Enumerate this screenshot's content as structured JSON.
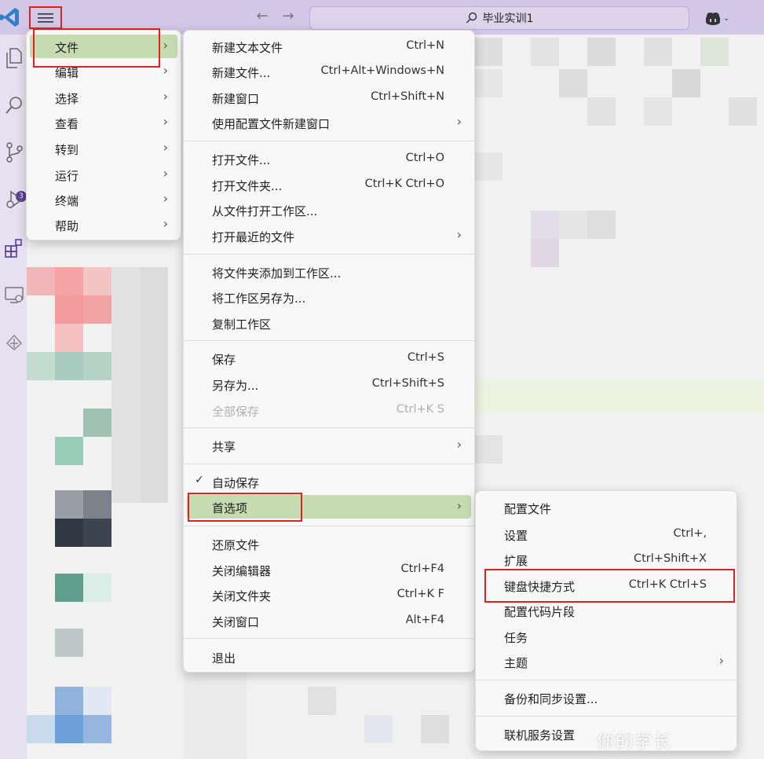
{
  "titlebar": {
    "search_text": "毕业实训1",
    "copilot_icon": "copilot-icon",
    "back_icon": "arrow-left-icon",
    "forward_icon": "arrow-right-icon"
  },
  "activitybar": {
    "icons": [
      "explorer-icon",
      "search-icon",
      "source-control-icon",
      "run-debug-icon",
      "extensions-icon",
      "remote-explorer-icon",
      "other-icon"
    ],
    "source_control_badge": "3"
  },
  "main_menu": {
    "items": [
      {
        "label": "文件",
        "submenu": true
      },
      {
        "label": "编辑",
        "submenu": true
      },
      {
        "label": "选择",
        "submenu": true
      },
      {
        "label": "查看",
        "submenu": true
      },
      {
        "label": "转到",
        "submenu": true
      },
      {
        "label": "运行",
        "submenu": true
      },
      {
        "label": "终端",
        "submenu": true
      },
      {
        "label": "帮助",
        "submenu": true
      }
    ]
  },
  "file_menu": {
    "groups": [
      [
        {
          "label": "新建文本文件",
          "shortcut": "Ctrl+N"
        },
        {
          "label": "新建文件...",
          "shortcut": "Ctrl+Alt+Windows+N"
        },
        {
          "label": "新建窗口",
          "shortcut": "Ctrl+Shift+N"
        },
        {
          "label": "使用配置文件新建窗口",
          "shortcut": "",
          "submenu": true
        }
      ],
      [
        {
          "label": "打开文件...",
          "shortcut": "Ctrl+O"
        },
        {
          "label": "打开文件夹...",
          "shortcut": "Ctrl+K Ctrl+O"
        },
        {
          "label": "从文件打开工作区...",
          "shortcut": ""
        },
        {
          "label": "打开最近的文件",
          "shortcut": "",
          "submenu": true
        }
      ],
      [
        {
          "label": "将文件夹添加到工作区...",
          "shortcut": ""
        },
        {
          "label": "将工作区另存为...",
          "shortcut": ""
        },
        {
          "label": "复制工作区",
          "shortcut": ""
        }
      ],
      [
        {
          "label": "保存",
          "shortcut": "Ctrl+S"
        },
        {
          "label": "另存为...",
          "shortcut": "Ctrl+Shift+S"
        },
        {
          "label": "全部保存",
          "shortcut": "Ctrl+K S",
          "disabled": true
        }
      ],
      [
        {
          "label": "共享",
          "shortcut": "",
          "submenu": true
        }
      ],
      [
        {
          "label": "自动保存",
          "shortcut": "",
          "checked": true
        },
        {
          "label": "首选项",
          "shortcut": "",
          "submenu": true,
          "highlighted": true
        }
      ],
      [
        {
          "label": "还原文件",
          "shortcut": ""
        },
        {
          "label": "关闭编辑器",
          "shortcut": "Ctrl+F4"
        },
        {
          "label": "关闭文件夹",
          "shortcut": "Ctrl+K F"
        },
        {
          "label": "关闭窗口",
          "shortcut": "Alt+F4"
        }
      ],
      [
        {
          "label": "退出",
          "shortcut": ""
        }
      ]
    ]
  },
  "preferences_menu": {
    "groups": [
      [
        {
          "label": "配置文件",
          "shortcut": ""
        },
        {
          "label": "设置",
          "shortcut": "Ctrl+,"
        },
        {
          "label": "扩展",
          "shortcut": "Ctrl+Shift+X"
        },
        {
          "label": "键盘快捷方式",
          "shortcut": "Ctrl+K Ctrl+S"
        },
        {
          "label": "配置代码片段",
          "shortcut": ""
        },
        {
          "label": "任务",
          "shortcut": ""
        },
        {
          "label": "主题",
          "shortcut": "",
          "submenu": true
        }
      ],
      [
        {
          "label": "备份和同步设置...",
          "shortcut": ""
        }
      ],
      [
        {
          "label": "联机服务设置",
          "shortcut": ""
        }
      ]
    ]
  },
  "watermark": "你的学长",
  "colors": {
    "titlebar": "#d2c7e6",
    "highlight": "#c6dbb0",
    "annotation_red": "#e01f1f",
    "menu_bg": "#f8f8f8"
  }
}
